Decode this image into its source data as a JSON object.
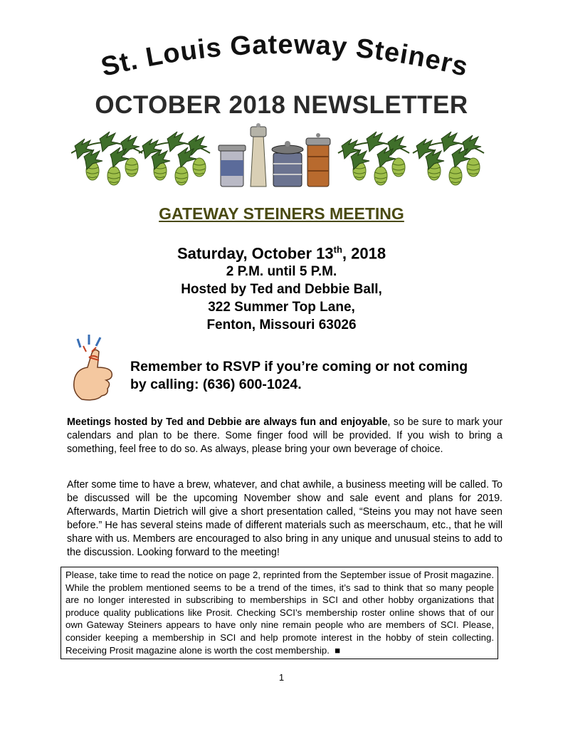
{
  "masthead": {
    "club_name": "St. Louis Gateway Steiners"
  },
  "newsletter_title": "OCTOBER 2018 NEWSLETTER",
  "banner": {
    "image_description_icon": "hops-and-steins-banner"
  },
  "meeting": {
    "heading": "GATEWAY STEINERS MEETING",
    "date_prefix": "Saturday, October 13",
    "date_suffix": "th",
    "date_year": ", 2018",
    "time": "2 P.M. until 5 P.M.",
    "hosts": "Hosted by Ted and Debbie Ball,",
    "street": "322 Summer Top Lane,",
    "city": "Fenton, Missouri 63026"
  },
  "rsvp": {
    "icon": "finger-string-reminder-icon",
    "line1": "Remember to RSVP if you’re coming or not coming",
    "line2": "by calling: (636) 600-1024."
  },
  "body": {
    "para1_bold": "Meetings hosted by Ted and Debbie are always fun and enjoyable",
    "para1_rest": ", so be sure to mark your calendars and plan to be there. Some finger food will be provided. If you wish to bring a something, feel free to do so. As always, please bring your own beverage of choice.",
    "para2": "After some time to have a brew, whatever, and chat awhile, a business meeting will be called. To be discussed will be the upcoming November show and sale event and plans for 2019. Afterwards, Martin Dietrich will give a short presentation called, “Steins you may not have seen before.” He has several steins made of different materials such as meerschaum, etc., that he will share with us. Members are encouraged to also bring in any unique and unusual steins to add to the discussion. Looking forward to the meeting!"
  },
  "notice": {
    "text": "Please, take time to read the notice on page 2, reprinted from the September issue of Prosit magazine. While the problem mentioned seems to be a trend of the times, it’s sad to think that so many people are no longer interested in subscribing to memberships in SCI and other hobby organizations that produce quality publications like Prosit. Checking SCI’s membership roster online shows that of our own Gateway Steiners appears to have only nine remain people who are members of SCI. Please, consider keeping a membership in SCI and help promote interest in the hobby of stein collecting. Receiving Prosit magazine alone is worth the cost membership.",
    "end_mark": "■"
  },
  "page_number": "1"
}
